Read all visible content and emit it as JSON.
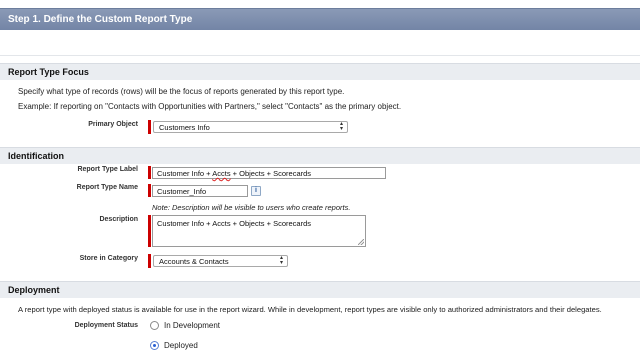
{
  "header": {
    "title": "Step 1. Define the Custom Report Type"
  },
  "focus": {
    "section_title": "Report Type Focus",
    "description": "Specify what type of records (rows) will be the focus of reports generated by this report type.",
    "example": "Example: If reporting on \"Contacts with Opportunities with Partners,\" select \"Contacts\" as the primary object.",
    "primary_object_label": "Primary Object",
    "primary_object_value": "Customers Info"
  },
  "identification": {
    "section_title": "Identification",
    "report_type_label_label": "Report Type Label",
    "report_type_label_value_a": "Customer Info + ",
    "report_type_label_value_b": "Accts",
    "report_type_label_value_c": " + Objects + Scorecards",
    "report_type_name_label": "Report Type Name",
    "report_type_name_value": "Customer_Info",
    "info_glyph": "i",
    "note": "Note: Description will be visible to users who create reports.",
    "description_label": "Description",
    "description_value": "Customer Info + Accts + Objects + Scorecards",
    "category_label": "Store in Category",
    "category_value": "Accounts & Contacts"
  },
  "deployment": {
    "section_title": "Deployment",
    "description": "A report type with deployed status is available for use in the report wizard. While in development, report types are visible only to authorized administrators and their delegates.",
    "status_label": "Deployment Status",
    "options": [
      {
        "label": "In Development",
        "selected": false
      },
      {
        "label": "Deployed",
        "selected": true
      }
    ]
  },
  "colors": {
    "header_bg": "#7d8eae",
    "section_bg": "#eaedf1",
    "required": "#cc0000",
    "radio_accent": "#2a5fd4"
  },
  "icons": {
    "info": "info-icon",
    "select_arrows": "select-arrows-icon",
    "resize": "resize-grip-icon"
  }
}
